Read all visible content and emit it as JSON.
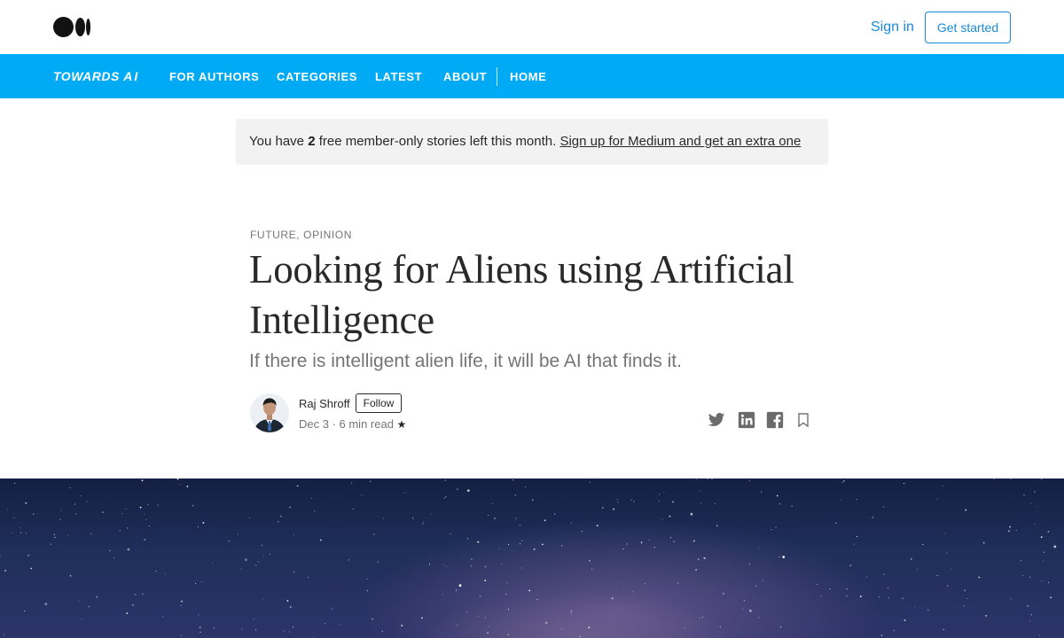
{
  "header": {
    "logo_icon": "medium-logo-icon",
    "sign_in": "Sign in",
    "get_started": "Get started"
  },
  "publication": {
    "name_part1": "TOWARDS",
    "name_part2": "AI",
    "nav": [
      "FOR AUTHORS",
      "CATEGORIES",
      "LATEST",
      "ABOUT",
      "HOME"
    ]
  },
  "banner": {
    "prefix": "You have ",
    "count": "2",
    "suffix": " free member-only stories left this month. ",
    "link": "Sign up for Medium and get an extra one"
  },
  "article": {
    "kicker": "FUTURE, OPINION",
    "title": "Looking for Aliens using Artificial Intelligence",
    "subtitle": "If there is intelligent alien life, it will be AI that finds it.",
    "author": "Raj Shroff",
    "follow": "Follow",
    "meta": "Dec 3 · 6 min read",
    "star": "★"
  },
  "share_icons": [
    "twitter-icon",
    "linkedin-icon",
    "facebook-icon",
    "bookmark-icon"
  ],
  "colors": {
    "accent": "#1a8bd9",
    "nav_background": "#00aaf4",
    "banner_background": "#f2f2f2"
  }
}
